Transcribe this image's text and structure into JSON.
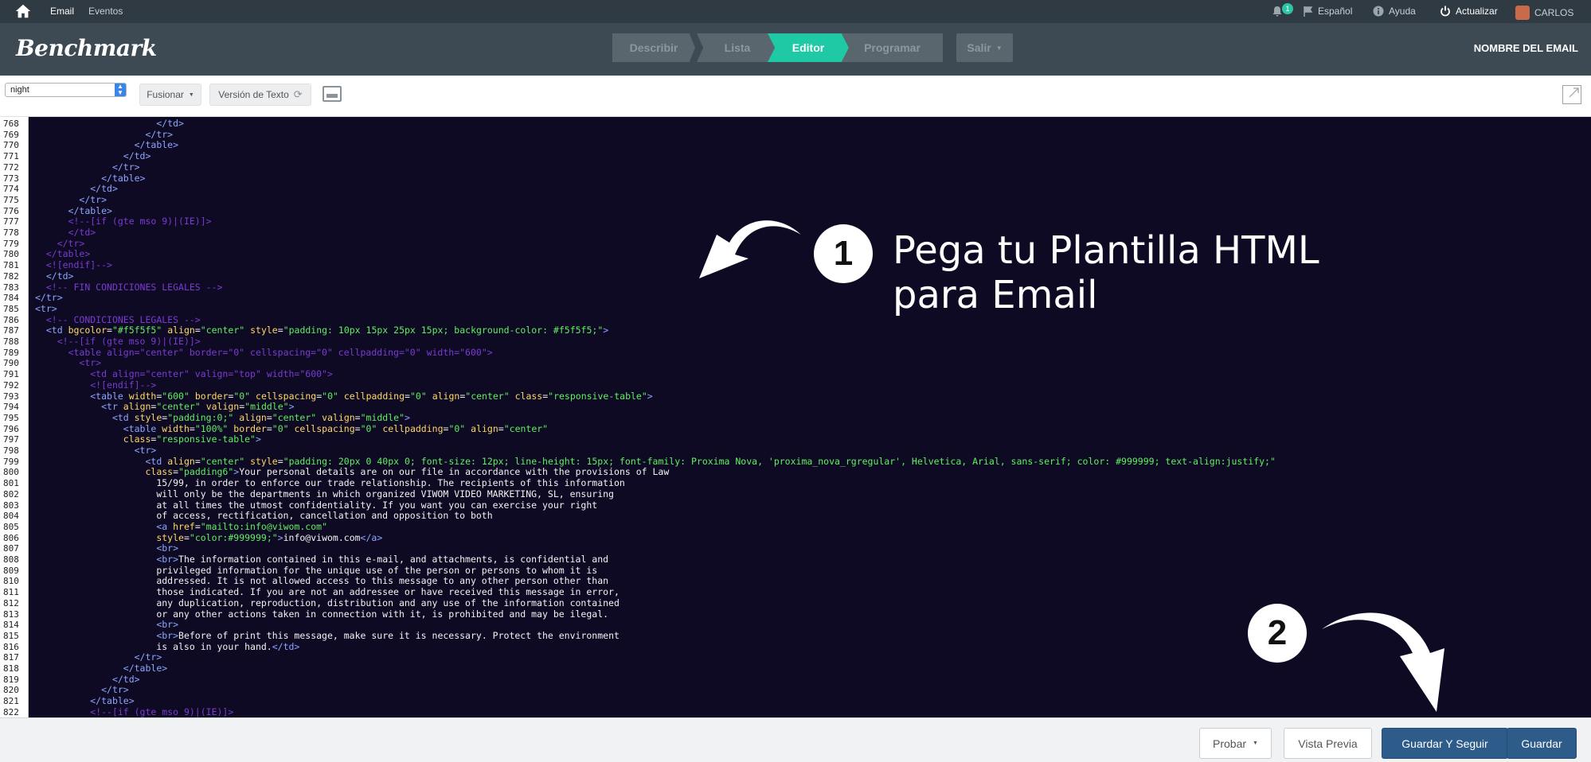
{
  "topbar": {
    "home_icon": "home-icon",
    "tab_email": "Email",
    "tab_eventos": "Eventos",
    "notification_count": "1",
    "language": "Español",
    "help": "Ayuda",
    "upgrade": "Actualizar",
    "user": "CARLOS"
  },
  "header": {
    "logo": "Benchmark",
    "steps": [
      "Describir",
      "Lista",
      "Editor",
      "Programar"
    ],
    "active_step": "Editor",
    "exit": "Salir",
    "email_name": "NOMBRE DEL EMAIL"
  },
  "toolbar": {
    "theme_value": "night",
    "merge": "Fusionar",
    "text_version": "Versión de Texto"
  },
  "editor": {
    "line_numbers": [
      "768",
      "769",
      "770",
      "771",
      "772",
      "773",
      "774",
      "775",
      "776",
      "777",
      "778",
      "779",
      "780",
      "781",
      "782",
      "783",
      "784",
      "785",
      "786",
      "787",
      "788",
      "789",
      "790",
      "791",
      "792",
      "793",
      "794",
      "795",
      "796",
      "797",
      "798",
      "799",
      "800",
      "801",
      "802",
      "803",
      "804",
      "805",
      "806",
      "807",
      "808",
      "809",
      "810",
      "811",
      "812",
      "813",
      "814",
      "815",
      "816",
      "817",
      "818",
      "819",
      "820",
      "821",
      "822"
    ],
    "lines": [
      [
        [
          "t",
          "                      "
        ],
        [
          "g",
          "</td>"
        ]
      ],
      [
        [
          "t",
          "                    "
        ],
        [
          "g",
          "</tr>"
        ]
      ],
      [
        [
          "t",
          "                  "
        ],
        [
          "g",
          "</table>"
        ]
      ],
      [
        [
          "t",
          "                "
        ],
        [
          "g",
          "</td>"
        ]
      ],
      [
        [
          "t",
          "              "
        ],
        [
          "g",
          "</tr>"
        ]
      ],
      [
        [
          "t",
          "            "
        ],
        [
          "g",
          "</table>"
        ]
      ],
      [
        [
          "t",
          "          "
        ],
        [
          "g",
          "</td>"
        ]
      ],
      [
        [
          "t",
          "        "
        ],
        [
          "g",
          "</tr>"
        ]
      ],
      [
        [
          "t",
          "      "
        ],
        [
          "g",
          "</table>"
        ]
      ],
      [
        [
          "t",
          "      "
        ],
        [
          "c",
          "<!--[if (gte mso 9)|(IE)]>"
        ]
      ],
      [
        [
          "t",
          "      "
        ],
        [
          "c",
          "</td>"
        ]
      ],
      [
        [
          "t",
          "    "
        ],
        [
          "c",
          "</tr>"
        ]
      ],
      [
        [
          "t",
          "  "
        ],
        [
          "c",
          "</table>"
        ]
      ],
      [
        [
          "t",
          "  "
        ],
        [
          "c",
          "<![endif]-->"
        ]
      ],
      [
        [
          "t",
          "  "
        ],
        [
          "g",
          "</td>"
        ]
      ],
      [
        [
          "t",
          "  "
        ],
        [
          "c",
          "<!-- FIN CONDICIONES LEGALES -->"
        ]
      ],
      [
        [
          "g",
          "</tr>"
        ]
      ],
      [
        [
          "g",
          "<tr>"
        ]
      ],
      [
        [
          "t",
          "  "
        ],
        [
          "c",
          "<!-- CONDICIONES LEGALES -->"
        ]
      ],
      [
        [
          "t",
          "  "
        ],
        [
          "g",
          "<td "
        ],
        [
          "a",
          "bgcolor"
        ],
        [
          "t",
          "="
        ],
        [
          "v",
          "\"#f5f5f5\""
        ],
        [
          "t",
          " "
        ],
        [
          "a",
          "align"
        ],
        [
          "t",
          "="
        ],
        [
          "v",
          "\"center\""
        ],
        [
          "t",
          " "
        ],
        [
          "a",
          "style"
        ],
        [
          "t",
          "="
        ],
        [
          "v",
          "\"padding: 10px 15px 25px 15px; background-color: #f5f5f5;\""
        ],
        [
          "g",
          ">"
        ]
      ],
      [
        [
          "t",
          "    "
        ],
        [
          "c",
          "<!--[if (gte mso 9)|(IE)]>"
        ]
      ],
      [
        [
          "t",
          "      "
        ],
        [
          "c",
          "<table align=\"center\" border=\"0\" cellspacing=\"0\" cellpadding=\"0\" width=\"600\">"
        ]
      ],
      [
        [
          "t",
          "        "
        ],
        [
          "c",
          "<tr>"
        ]
      ],
      [
        [
          "t",
          "          "
        ],
        [
          "c",
          "<td align=\"center\" valign=\"top\" width=\"600\">"
        ]
      ],
      [
        [
          "t",
          "          "
        ],
        [
          "c",
          "<![endif]-->"
        ]
      ],
      [
        [
          "t",
          "          "
        ],
        [
          "g",
          "<table "
        ],
        [
          "a",
          "width"
        ],
        [
          "t",
          "="
        ],
        [
          "v",
          "\"600\""
        ],
        [
          "t",
          " "
        ],
        [
          "a",
          "border"
        ],
        [
          "t",
          "="
        ],
        [
          "v",
          "\"0\""
        ],
        [
          "t",
          " "
        ],
        [
          "a",
          "cellspacing"
        ],
        [
          "t",
          "="
        ],
        [
          "v",
          "\"0\""
        ],
        [
          "t",
          " "
        ],
        [
          "a",
          "cellpadding"
        ],
        [
          "t",
          "="
        ],
        [
          "v",
          "\"0\""
        ],
        [
          "t",
          " "
        ],
        [
          "a",
          "align"
        ],
        [
          "t",
          "="
        ],
        [
          "v",
          "\"center\""
        ],
        [
          "t",
          " "
        ],
        [
          "a",
          "class"
        ],
        [
          "t",
          "="
        ],
        [
          "v",
          "\"responsive-table\""
        ],
        [
          "g",
          ">"
        ]
      ],
      [
        [
          "t",
          "            "
        ],
        [
          "g",
          "<tr "
        ],
        [
          "a",
          "align"
        ],
        [
          "t",
          "="
        ],
        [
          "v",
          "\"center\""
        ],
        [
          "t",
          " "
        ],
        [
          "a",
          "valign"
        ],
        [
          "t",
          "="
        ],
        [
          "v",
          "\"middle\""
        ],
        [
          "g",
          ">"
        ]
      ],
      [
        [
          "t",
          "              "
        ],
        [
          "g",
          "<td "
        ],
        [
          "a",
          "style"
        ],
        [
          "t",
          "="
        ],
        [
          "v",
          "\"padding:0;\""
        ],
        [
          "t",
          " "
        ],
        [
          "a",
          "align"
        ],
        [
          "t",
          "="
        ],
        [
          "v",
          "\"center\""
        ],
        [
          "t",
          " "
        ],
        [
          "a",
          "valign"
        ],
        [
          "t",
          "="
        ],
        [
          "v",
          "\"middle\""
        ],
        [
          "g",
          ">"
        ]
      ],
      [
        [
          "t",
          "                "
        ],
        [
          "g",
          "<table "
        ],
        [
          "a",
          "width"
        ],
        [
          "t",
          "="
        ],
        [
          "v",
          "\"100%\""
        ],
        [
          "t",
          " "
        ],
        [
          "a",
          "border"
        ],
        [
          "t",
          "="
        ],
        [
          "v",
          "\"0\""
        ],
        [
          "t",
          " "
        ],
        [
          "a",
          "cellspacing"
        ],
        [
          "t",
          "="
        ],
        [
          "v",
          "\"0\""
        ],
        [
          "t",
          " "
        ],
        [
          "a",
          "cellpadding"
        ],
        [
          "t",
          "="
        ],
        [
          "v",
          "\"0\""
        ],
        [
          "t",
          " "
        ],
        [
          "a",
          "align"
        ],
        [
          "t",
          "="
        ],
        [
          "v",
          "\"center\""
        ]
      ],
      [
        [
          "t",
          "                "
        ],
        [
          "a",
          "class"
        ],
        [
          "t",
          "="
        ],
        [
          "v",
          "\"responsive-table\""
        ],
        [
          "g",
          ">"
        ]
      ],
      [
        [
          "t",
          "                  "
        ],
        [
          "g",
          "<tr>"
        ]
      ],
      [
        [
          "t",
          "                    "
        ],
        [
          "g",
          "<td "
        ],
        [
          "a",
          "align"
        ],
        [
          "t",
          "="
        ],
        [
          "v",
          "\"center\""
        ],
        [
          "t",
          " "
        ],
        [
          "a",
          "style"
        ],
        [
          "t",
          "="
        ],
        [
          "v",
          "\"padding: 20px 0 40px 0; font-size: 12px; line-height: 15px; font-family: Proxima Nova, 'proxima_nova_rgregular', Helvetica, Arial, sans-serif; color: #999999; text-align:justify;\""
        ]
      ],
      [
        [
          "t",
          "                    "
        ],
        [
          "a",
          "class"
        ],
        [
          "t",
          "="
        ],
        [
          "v",
          "\"padding6\""
        ],
        [
          "g",
          ">"
        ],
        [
          "t",
          "Your personal details are on our file in accordance with the provisions of Law"
        ]
      ],
      [
        [
          "t",
          "                      15/99, in order to enforce our trade relationship. The recipients of this information"
        ]
      ],
      [
        [
          "t",
          "                      will only be the departments in which organized VIWOM VIDEO MARKETING, SL, ensuring"
        ]
      ],
      [
        [
          "t",
          "                      at all times the utmost confidentiality. If you want you can exercise your right"
        ]
      ],
      [
        [
          "t",
          "                      of access, rectification, cancellation and opposition to both"
        ]
      ],
      [
        [
          "t",
          "                      "
        ],
        [
          "g",
          "<a "
        ],
        [
          "a",
          "href"
        ],
        [
          "t",
          "="
        ],
        [
          "v",
          "\"mailto:info@viwom.com\""
        ]
      ],
      [
        [
          "t",
          "                      "
        ],
        [
          "a",
          "style"
        ],
        [
          "t",
          "="
        ],
        [
          "v",
          "\"color:#999999;\""
        ],
        [
          "g",
          ">"
        ],
        [
          "t",
          "info@viwom.com"
        ],
        [
          "g",
          "</a>"
        ]
      ],
      [
        [
          "t",
          "                      "
        ],
        [
          "g",
          "<br>"
        ]
      ],
      [
        [
          "t",
          "                      "
        ],
        [
          "g",
          "<br>"
        ],
        [
          "t",
          "The information contained in this e-mail, and attachments, is confidential and"
        ]
      ],
      [
        [
          "t",
          "                      privileged information for the unique use of the person or persons to whom it is"
        ]
      ],
      [
        [
          "t",
          "                      addressed. It is not allowed access to this message to any other person other than"
        ]
      ],
      [
        [
          "t",
          "                      those indicated. If you are not an addressee or have received this message in error,"
        ]
      ],
      [
        [
          "t",
          "                      any duplication, reproduction, distribution and any use of the information contained"
        ]
      ],
      [
        [
          "t",
          "                      or any other actions taken in connection with it, is prohibited and may be ilegal."
        ]
      ],
      [
        [
          "t",
          "                      "
        ],
        [
          "g",
          "<br>"
        ]
      ],
      [
        [
          "t",
          "                      "
        ],
        [
          "g",
          "<br>"
        ],
        [
          "t",
          "Before of print this message, make sure it is necessary. Protect the environment"
        ]
      ],
      [
        [
          "t",
          "                      is also in your hand."
        ],
        [
          "g",
          "</td>"
        ]
      ],
      [
        [
          "t",
          "                  "
        ],
        [
          "g",
          "</tr>"
        ]
      ],
      [
        [
          "t",
          "                "
        ],
        [
          "g",
          "</table>"
        ]
      ],
      [
        [
          "t",
          "              "
        ],
        [
          "g",
          "</td>"
        ]
      ],
      [
        [
          "t",
          "            "
        ],
        [
          "g",
          "</tr>"
        ]
      ],
      [
        [
          "t",
          "          "
        ],
        [
          "g",
          "</table>"
        ]
      ],
      [
        [
          "t",
          "          "
        ],
        [
          "c",
          "<!--[if (gte mso 9)|(IE)]>"
        ]
      ]
    ],
    "colors": {
      "background": "#0e0a24",
      "tag": "#8da6ff",
      "attribute": "#ffd866",
      "value": "#5ff05f",
      "text": "#f2f2f2",
      "comment": "#7a3bd1"
    }
  },
  "annotations": {
    "step1_number": "1",
    "step1_line1": "Pega tu Plantilla HTML",
    "step1_line2": "para Email",
    "step2_number": "2"
  },
  "footer": {
    "test": "Probar",
    "preview": "Vista Previa",
    "save_continue": "Guardar Y Seguir",
    "save": "Guardar"
  },
  "colors": {
    "accent": "#1fc9a6",
    "primary_button": "#2d5b8a",
    "topbar": "#2f3a42",
    "header": "#3d4a53"
  }
}
